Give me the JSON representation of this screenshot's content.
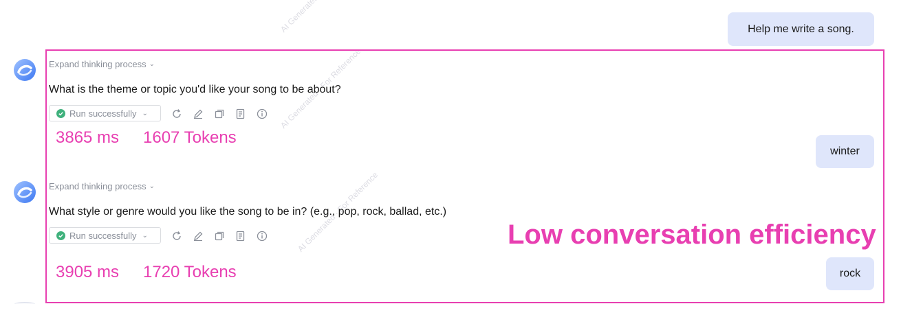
{
  "conversation": {
    "messages": [
      {
        "role": "user",
        "text": "Help me write a song."
      },
      {
        "role": "assistant",
        "thinking_label": "Expand thinking process",
        "text": "What is the theme or topic you'd like your song to be about?",
        "status": "Run successfully",
        "latency": "3865 ms",
        "tokens": "1607 Tokens"
      },
      {
        "role": "user",
        "text": "winter"
      },
      {
        "role": "assistant",
        "thinking_label": "Expand thinking process",
        "text": "What style or genre would you like the song to be in? (e.g., pop, rock, ballad, etc.)",
        "status": "Run successfully",
        "latency": "3905 ms",
        "tokens": "1720 Tokens"
      },
      {
        "role": "user",
        "text": "rock"
      }
    ]
  },
  "annotation": {
    "label": "Low conversation efficiency",
    "color": "#e83fb1"
  },
  "toolbar_icons": [
    "refresh-icon",
    "edit-icon",
    "copy-icon",
    "note-icon",
    "info-icon"
  ],
  "colors": {
    "user_bubble": "#dfe6fb",
    "success": "#3fb17c",
    "accent": "#e83fb1"
  }
}
